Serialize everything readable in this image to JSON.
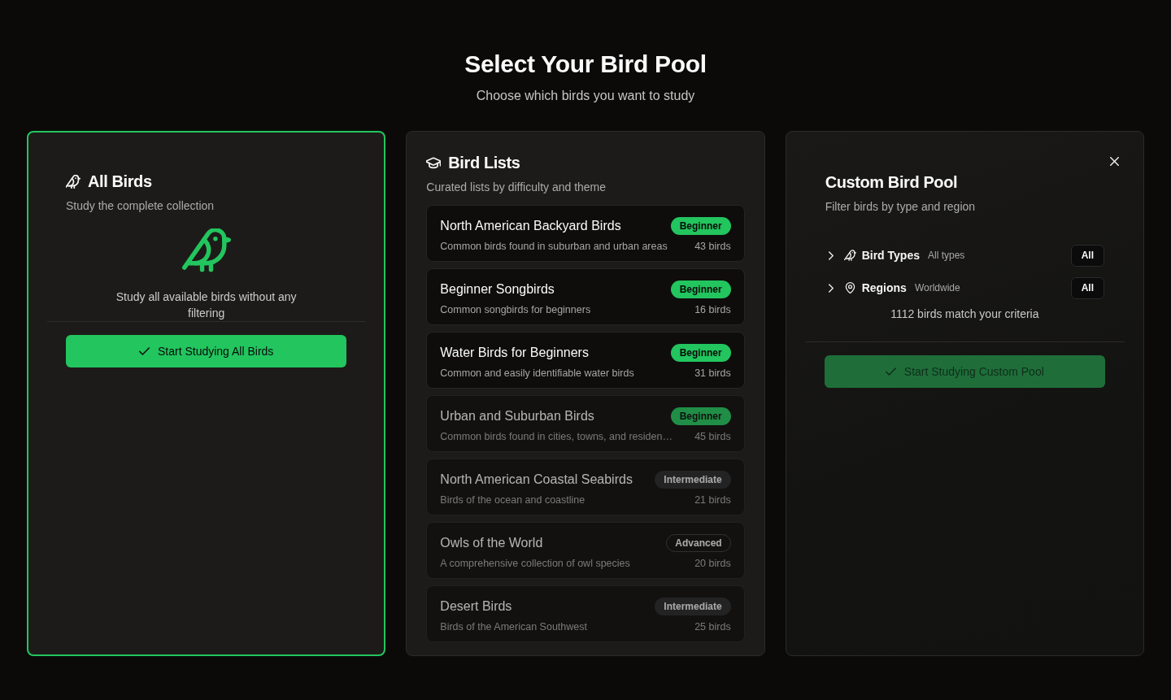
{
  "heading": {
    "title": "Select Your Bird Pool",
    "subtitle": "Choose which birds you want to study"
  },
  "cards": [
    {
      "kind": "all",
      "selected": true,
      "title": "All Birds",
      "subtitle": "Study the complete collection",
      "description": "Study all available birds without any filtering",
      "button": {
        "label": "Start Studying All Birds",
        "muted": false
      }
    },
    {
      "kind": "lists",
      "selected": false,
      "title": "Bird Lists",
      "subtitle": "Curated lists by difficulty and theme",
      "lists": [
        {
          "name": "North American Backyard Birds",
          "description": "Common birds found in suburban and urban areas",
          "count": "43 birds",
          "badge": {
            "label": "Beginner",
            "kind": "beginner"
          },
          "dimmed": false
        },
        {
          "name": "Beginner Songbirds",
          "description": "Common songbirds for beginners",
          "count": "16 birds",
          "badge": {
            "label": "Beginner",
            "kind": "beginner"
          },
          "dimmed": false
        },
        {
          "name": "Water Birds for Beginners",
          "description": "Common and easily identifiable water birds",
          "count": "31 birds",
          "badge": {
            "label": "Beginner",
            "kind": "beginner"
          },
          "dimmed": false
        },
        {
          "name": "Urban and Suburban Birds",
          "description": "Common birds found in cities, towns, and residen…",
          "count": "45 birds",
          "badge": {
            "label": "Beginner",
            "kind": "beginner"
          },
          "dimmed": true
        },
        {
          "name": "North American Coastal Seabirds",
          "description": "Birds of the ocean and coastline",
          "count": "21 birds",
          "badge": {
            "label": "Intermediate",
            "kind": "intermediate"
          },
          "dimmed": true
        },
        {
          "name": "Owls of the World",
          "description": "A comprehensive collection of owl species",
          "count": "20 birds",
          "badge": {
            "label": "Advanced",
            "kind": "advanced"
          },
          "dimmed": true
        },
        {
          "name": "Desert Birds",
          "description": "Birds of the American Southwest",
          "count": "25 birds",
          "badge": {
            "label": "Intermediate",
            "kind": "intermediate"
          },
          "dimmed": true
        }
      ]
    },
    {
      "kind": "custom",
      "selected": false,
      "title": "Custom Bird Pool",
      "subtitle": "Filter birds by type and region",
      "filters": [
        {
          "kind": "types",
          "label": "Bird Types",
          "value": "All types",
          "button": "All",
          "expanded": false
        },
        {
          "kind": "regions",
          "label": "Regions",
          "value": "Worldwide",
          "button": "All",
          "expanded": false
        }
      ],
      "match_text": "1112 birds match your criteria",
      "button": {
        "label": "Start Studying Custom Pool",
        "muted": true
      }
    }
  ]
}
